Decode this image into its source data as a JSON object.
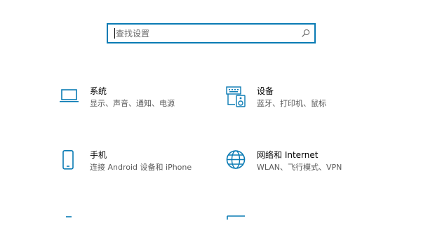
{
  "search": {
    "placeholder": "查找设置"
  },
  "categories": [
    {
      "title": "系统",
      "desc": "显示、声音、通知、电源",
      "icon": "laptop-icon"
    },
    {
      "title": "设备",
      "desc": "蓝牙、打印机、鼠标",
      "icon": "keyboard-speaker-icon"
    },
    {
      "title": "手机",
      "desc": "连接 Android 设备和 iPhone",
      "icon": "phone-icon"
    },
    {
      "title": "网络和 Internet",
      "desc": "WLAN、飞行模式、VPN",
      "icon": "globe-icon"
    }
  ],
  "colors": {
    "accent": "#0a7bb4",
    "text": "#000000",
    "subtext": "#5a5a5a"
  }
}
